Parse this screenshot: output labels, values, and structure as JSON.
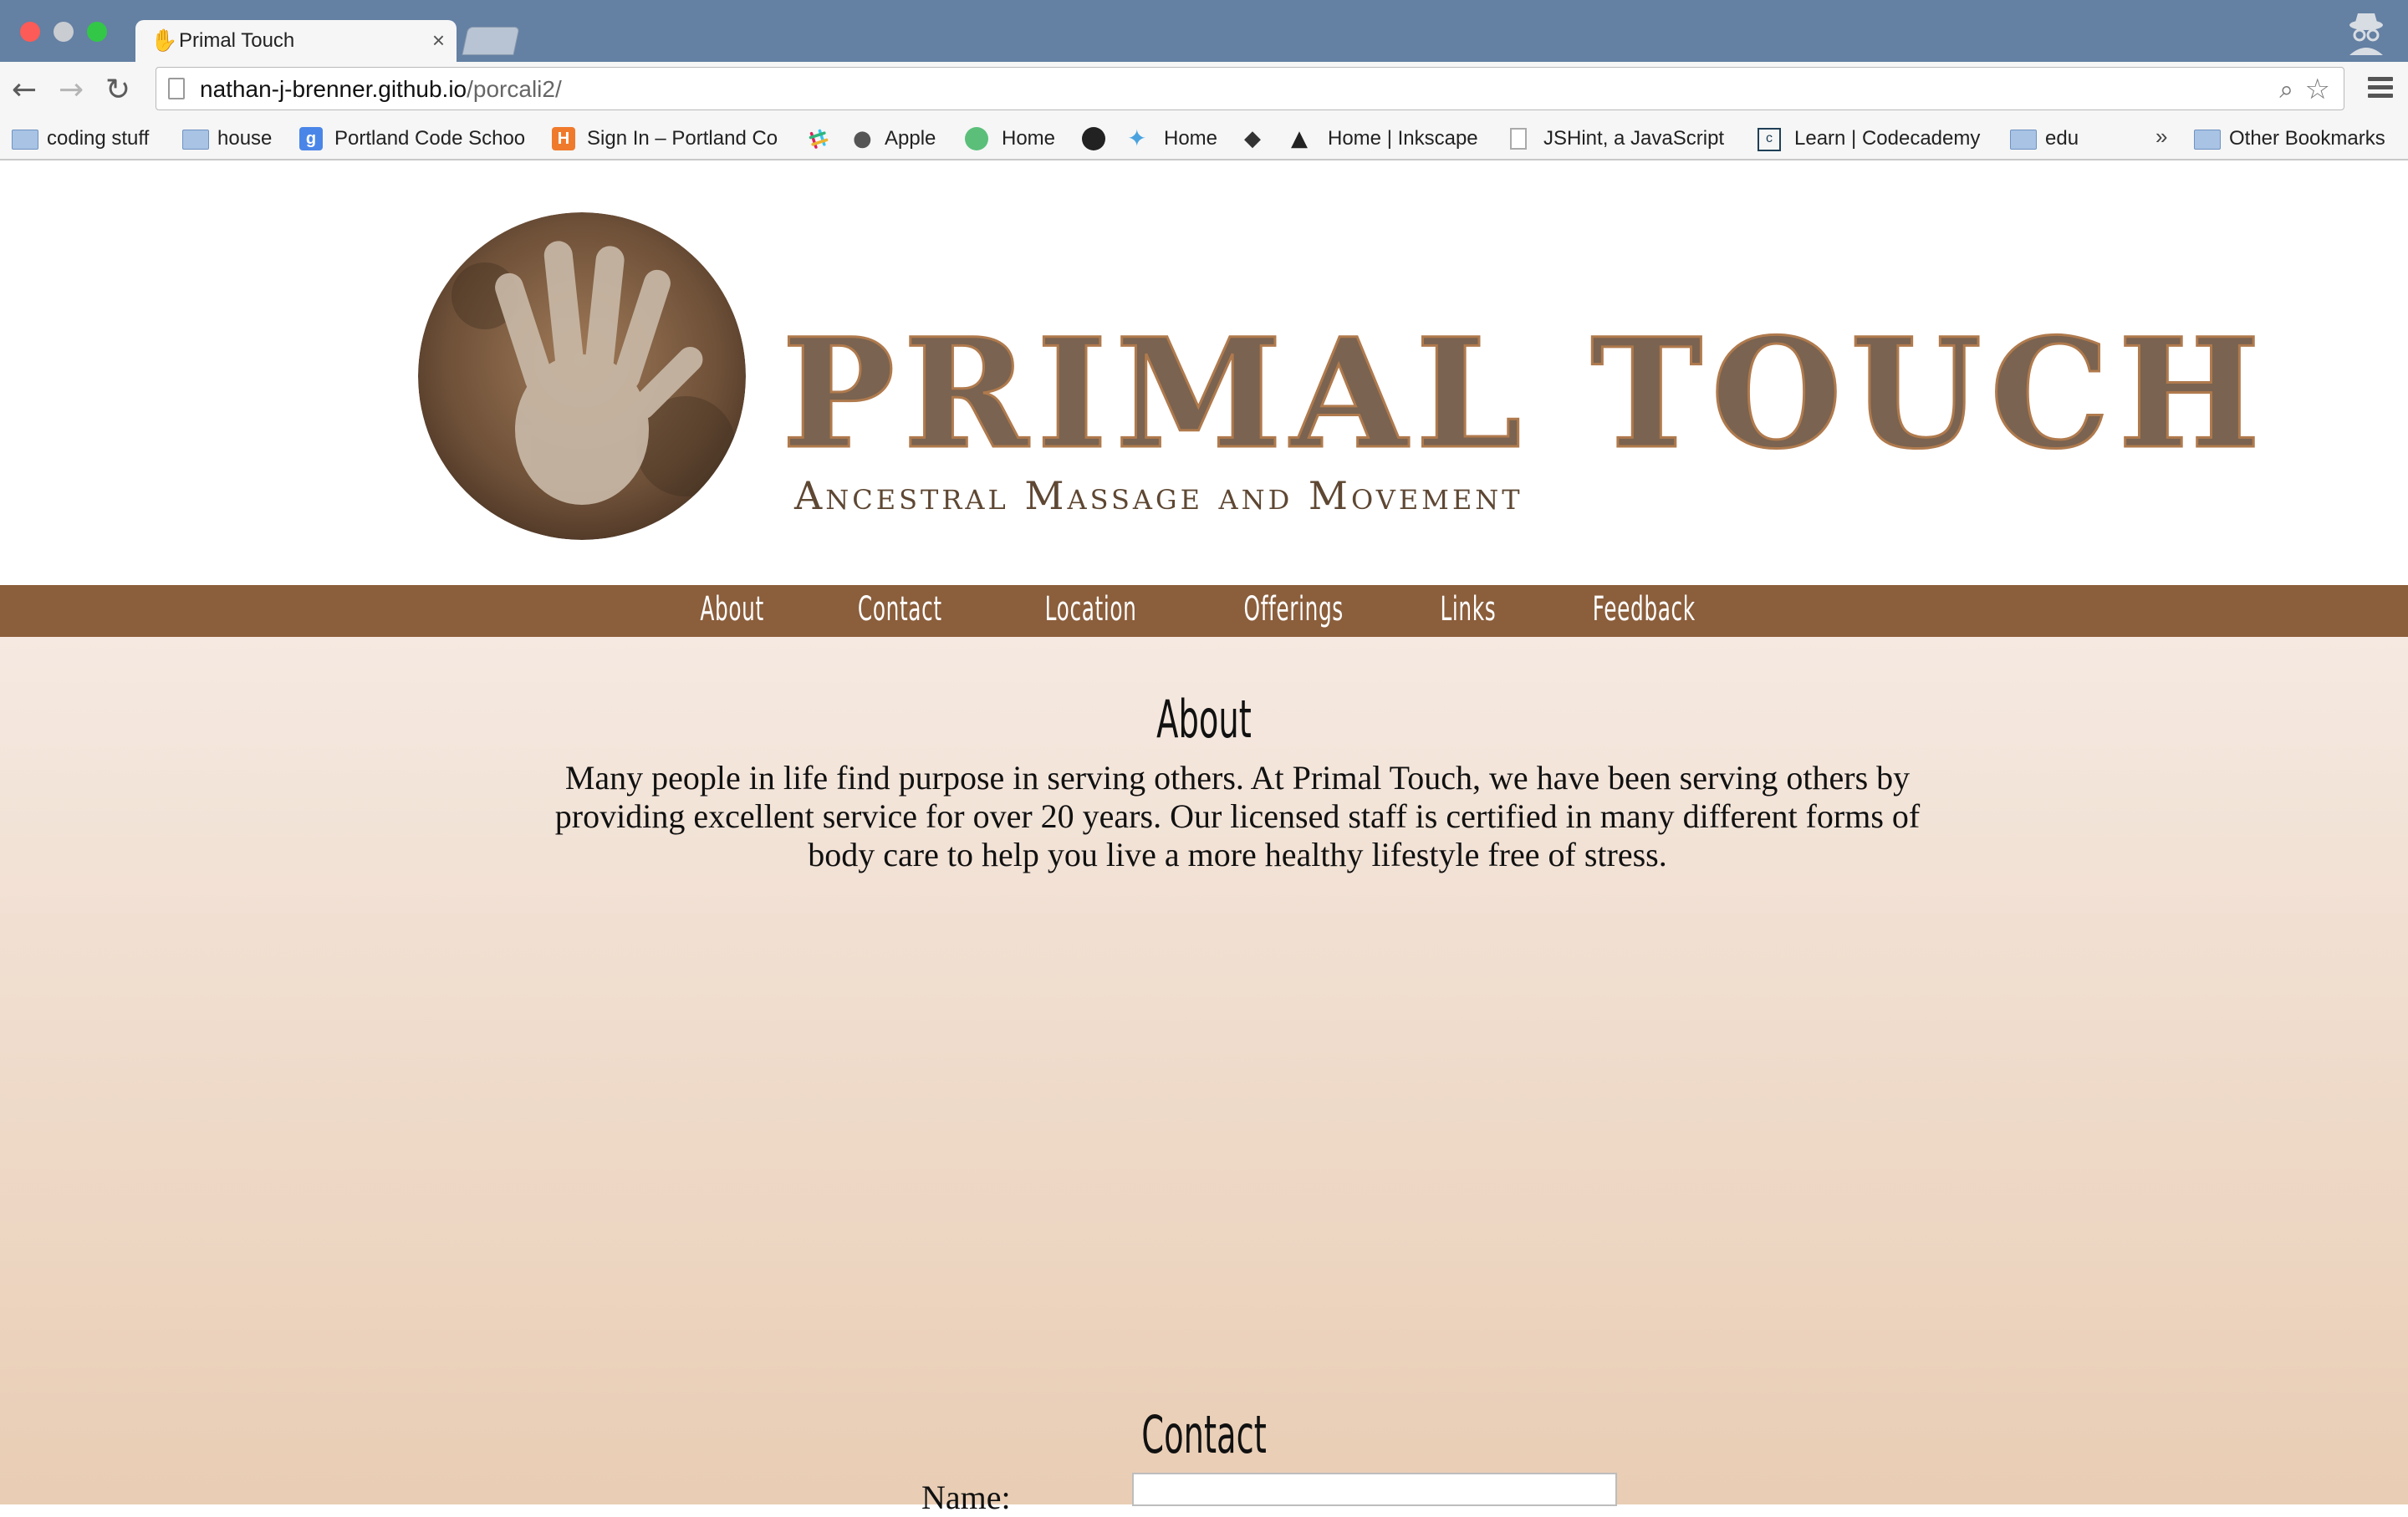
{
  "browser": {
    "tab_title": "Primal Touch",
    "tab_close": "×",
    "url_host": "nathan-j-brenner.github.io",
    "url_path": "/porcali2/",
    "icons": [
      "back-icon",
      "forward-icon",
      "reload-icon",
      "page-icon",
      "zoom-icon",
      "star-icon",
      "menu-icon",
      "incognito-icon"
    ]
  },
  "bookmarks": {
    "items": [
      {
        "label": "coding stuff",
        "icon": "folder-icon"
      },
      {
        "label": "house",
        "icon": "folder-icon"
      },
      {
        "label": "Portland Code Schoo",
        "icon": "google-icon"
      },
      {
        "label": "Sign In – Portland Co",
        "icon": "h-icon"
      },
      {
        "label": "",
        "icon": "slack-icon"
      },
      {
        "label": "Apple",
        "icon": "apple-icon"
      },
      {
        "label": "Home",
        "icon": "leaf-icon"
      },
      {
        "label": "",
        "icon": "github-icon"
      },
      {
        "label": "Home",
        "icon": "twitter-icon"
      },
      {
        "label": "",
        "icon": "diamond-icon"
      },
      {
        "label": "Home | Inkscape",
        "icon": "inkscape-icon"
      },
      {
        "label": "JSHint, a JavaScript",
        "icon": "page-icon"
      },
      {
        "label": "Learn | Codecademy",
        "icon": "codecademy-icon"
      },
      {
        "label": "edu",
        "icon": "folder-icon"
      }
    ],
    "more": "»",
    "other": "Other Bookmarks"
  },
  "site": {
    "brand_title": "PRIMAL TOUCH",
    "brand_subtitle": "Ancestral Massage and Movement",
    "nav": [
      "About",
      "Contact",
      "Location",
      "Offerings",
      "Links",
      "Feedback"
    ],
    "about": {
      "title": "About",
      "text": "Many people in life find purpose in serving others. At Primal Touch, we have been serving others by providing excellent service for over 20 years. Our licensed staff is certified in many different forms of body care to help you live a more healthy lifestyle free of stress."
    },
    "contact": {
      "title": "Contact",
      "name_label": "Name:",
      "name_value": ""
    }
  },
  "colors": {
    "titlebar": "#6480a3",
    "navbar": "#8b5e3c",
    "content_top": "#f5e9e1",
    "content_bottom": "#e9cdb4",
    "brand": "#7a6350"
  }
}
